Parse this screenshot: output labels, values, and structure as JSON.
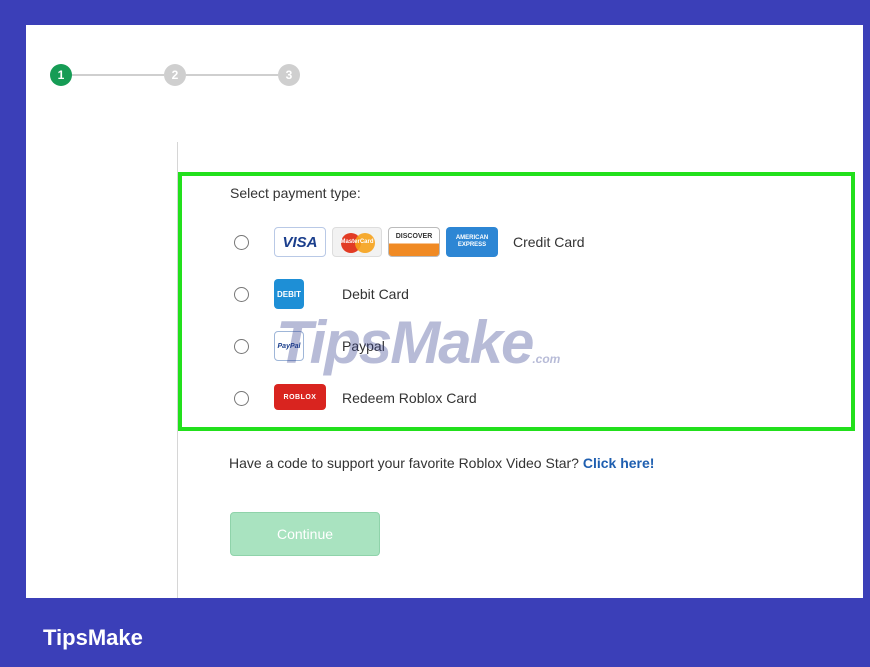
{
  "stepper": {
    "steps": [
      "1",
      "2",
      "3"
    ],
    "active_step": 1,
    "active_color": "#169c55",
    "inactive_color": "#cfcfcf"
  },
  "payment": {
    "heading": "Select payment type:",
    "options": [
      {
        "label": "Credit Card",
        "cards": [
          "VISA",
          "MasterCard",
          "DISCOVER",
          "AMERICAN EXPRESS"
        ]
      },
      {
        "label": "Debit Card",
        "cards": [
          "DEBIT"
        ]
      },
      {
        "label": "Paypal",
        "cards": [
          "PayPal"
        ]
      },
      {
        "label": "Redeem Roblox Card",
        "cards": [
          "ROBLOX"
        ]
      }
    ],
    "highlight_color": "#22e01c"
  },
  "support": {
    "text": "Have a code to support your favorite Roblox Video Star?",
    "link": "Click here!"
  },
  "continue_label": "Continue",
  "watermark": {
    "text": "TipsMake",
    "suffix": ".com"
  },
  "brand": "TipsMake"
}
